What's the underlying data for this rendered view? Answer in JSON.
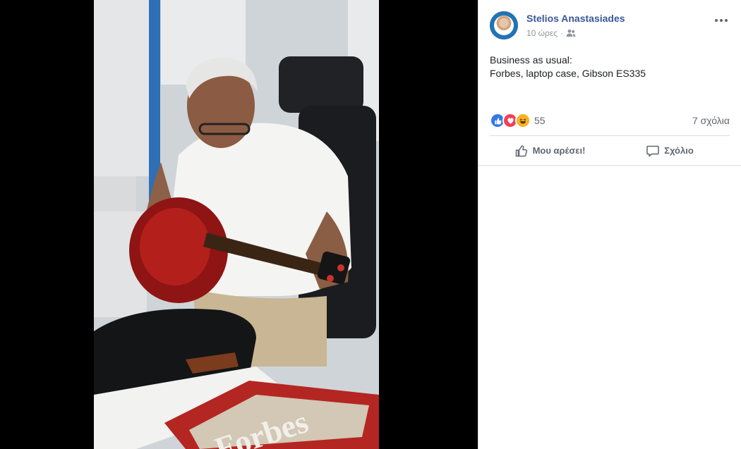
{
  "post": {
    "author": "Stelios Anastasiades",
    "timestamp": "10 ώρες",
    "separator": "·",
    "audience_icon": "friends-icon",
    "text_line1": "Business as usual:",
    "text_line2": "Forbes, laptop case, Gibson ES335"
  },
  "reactions": {
    "types": [
      "like",
      "love",
      "haha"
    ],
    "count": "55",
    "comments": "7 σχόλια"
  },
  "actions": {
    "like_label": "Μου αρέσει!",
    "comment_label": "Σχόλιο"
  },
  "colors": {
    "author_link": "#385898",
    "like": "#3578e5",
    "love": "#f33e58",
    "haha": "#f7b125",
    "secondary_text": "#606770"
  }
}
